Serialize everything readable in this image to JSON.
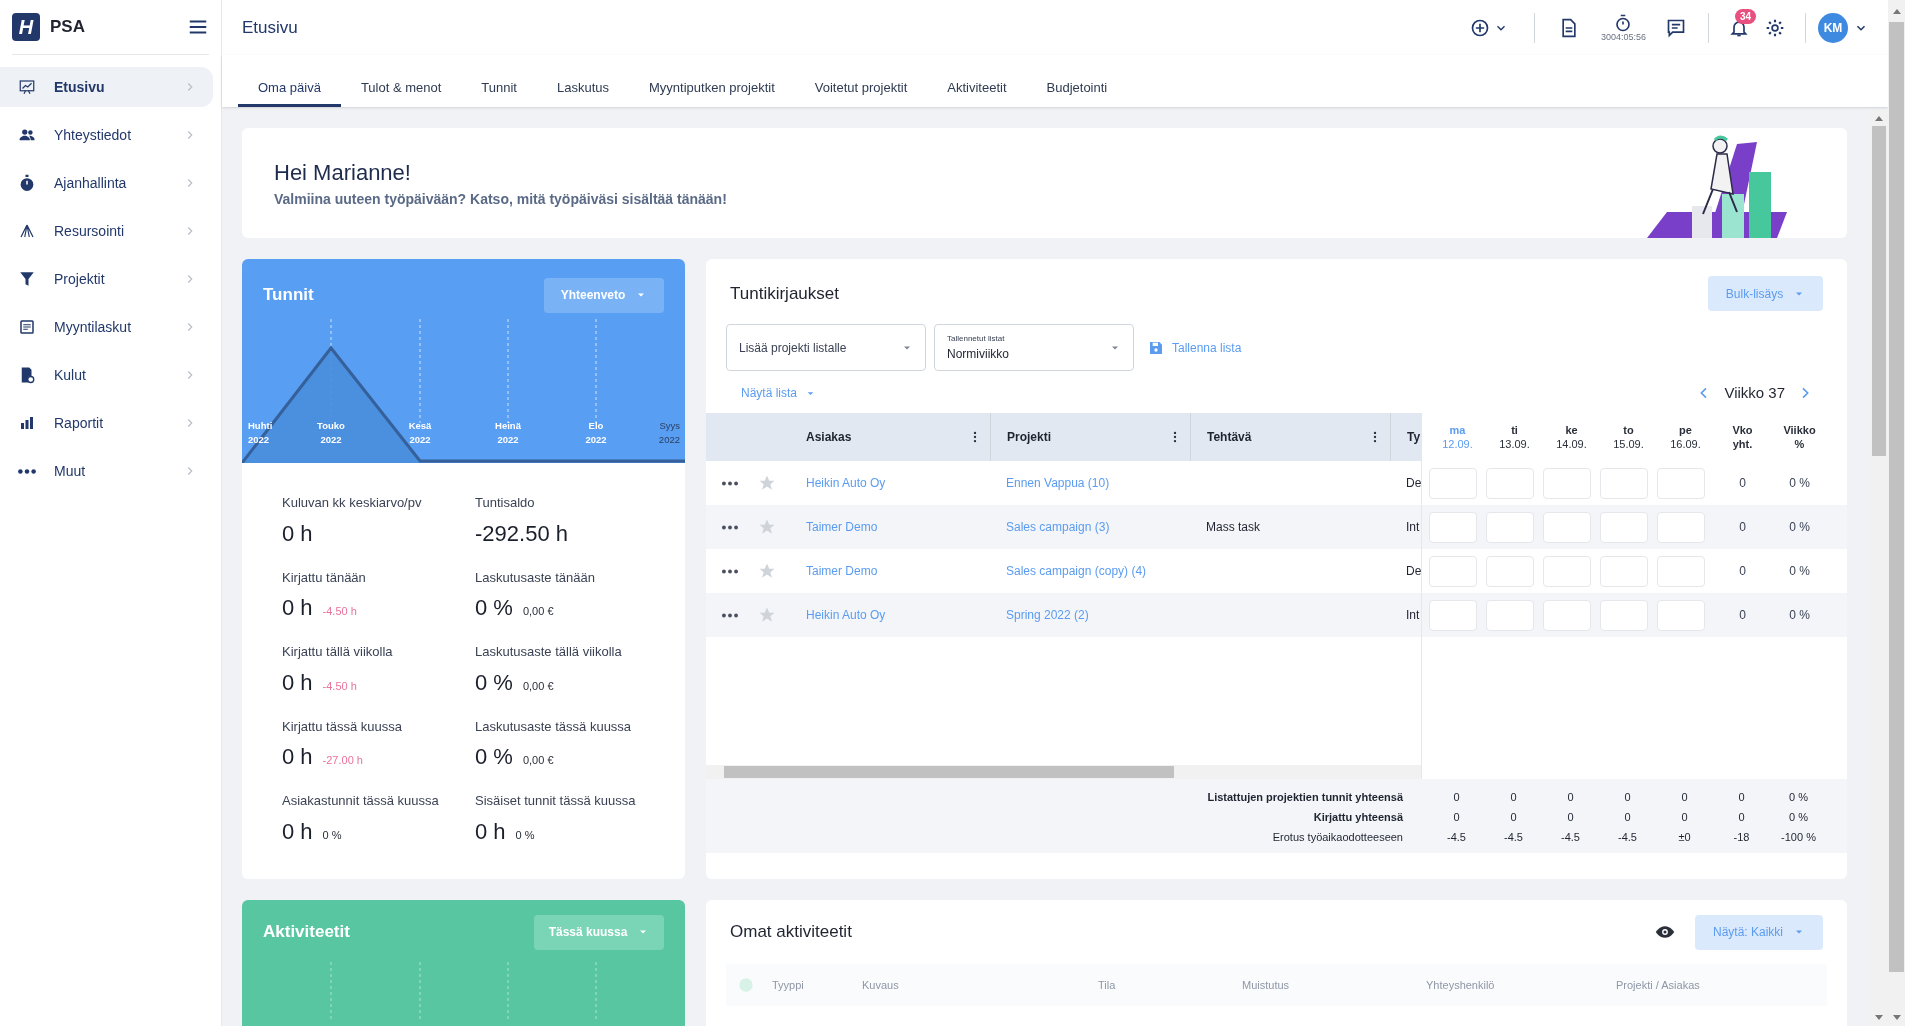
{
  "sidebar": {
    "logo_mark": "H",
    "brand": "PSA",
    "items": [
      {
        "label": "Etusivu",
        "kind": "dashboard",
        "selected": true
      },
      {
        "label": "Yhteystiedot",
        "kind": "people",
        "selected": false
      },
      {
        "label": "Ajanhallinta",
        "kind": "stopwatch",
        "selected": false
      },
      {
        "label": "Resursointi",
        "kind": "network",
        "selected": false
      },
      {
        "label": "Projektit",
        "kind": "funnel",
        "selected": false
      },
      {
        "label": "Myyntilaskut",
        "kind": "invoice",
        "selected": false
      },
      {
        "label": "Kulut",
        "kind": "receipt",
        "selected": false
      },
      {
        "label": "Raportit",
        "kind": "bars",
        "selected": false
      },
      {
        "label": "Muut",
        "kind": "dots",
        "selected": false
      }
    ]
  },
  "topbar": {
    "title": "Etusivu",
    "timer": "3004:05:56",
    "notifications": "34",
    "avatar": "KM"
  },
  "tabs": [
    {
      "label": "Oma päivä",
      "selected": true
    },
    {
      "label": "Tulot & menot",
      "selected": false
    },
    {
      "label": "Tunnit",
      "selected": false
    },
    {
      "label": "Laskutus",
      "selected": false
    },
    {
      "label": "Myyntiputken projektit",
      "selected": false
    },
    {
      "label": "Voitetut projektit",
      "selected": false
    },
    {
      "label": "Aktiviteetit",
      "selected": false
    },
    {
      "label": "Budjetointi",
      "selected": false
    }
  ],
  "greeting": {
    "title": "Hei Marianne!",
    "subtitle": "Valmiina uuteen työpäivään? Katso, mitä työpäiväsi sisältää tänään!"
  },
  "hours_card": {
    "title": "Tunnit",
    "dropdown": "Yhteenveto",
    "months": [
      {
        "month": "Huhti",
        "year": "2022"
      },
      {
        "month": "Touko",
        "year": "2022"
      },
      {
        "month": "Kesä",
        "year": "2022"
      },
      {
        "month": "Heinä",
        "year": "2022"
      },
      {
        "month": "Elo",
        "year": "2022"
      },
      {
        "month": "Syys",
        "year": "2022"
      }
    ],
    "stats": [
      {
        "label": "Kuluvan kk keskiarvo/pv",
        "value": "0 h"
      },
      {
        "label": "Tuntisaldo",
        "value": "-292.50 h"
      },
      {
        "label": "Kirjattu tänään",
        "value": "0 h",
        "note": "-4.50 h",
        "negative": true
      },
      {
        "label": "Laskutusaste tänään",
        "value": "0 %",
        "note": "0,00 €",
        "negative": false
      },
      {
        "label": "Kirjattu tällä viikolla",
        "value": "0 h",
        "note": "-4.50 h",
        "negative": true
      },
      {
        "label": "Laskutusaste tällä viikolla",
        "value": "0 %",
        "note": "0,00 €",
        "negative": false
      },
      {
        "label": "Kirjattu tässä kuussa",
        "value": "0 h",
        "note": "-27.00 h",
        "negative": true
      },
      {
        "label": "Laskutusaste tässä kuussa",
        "value": "0 %",
        "note": "0,00 €",
        "negative": false
      },
      {
        "label": "Asiakastunnit tässä kuussa",
        "value": "0 h",
        "note": "0 %",
        "negative": false
      },
      {
        "label": "Sisäiset tunnit tässä kuussa",
        "value": "0 h",
        "note": "0 %",
        "negative": false
      }
    ]
  },
  "entries_card": {
    "title": "Tuntikirjaukset",
    "bulk_button": "Bulk-lisäys",
    "project_select": {
      "placeholder": "Lisää projekti listalle"
    },
    "saved_lists": {
      "label": "Tallennetut listat",
      "value": "Normiviikko"
    },
    "save_link": "Tallenna lista",
    "show_list": "Näytä lista",
    "week": "Viikko 37",
    "columns": [
      "Asiakas",
      "Projekti",
      "Tehtävä",
      "Ty"
    ],
    "days": [
      {
        "day": "ma",
        "date": "12.09.",
        "selected": true
      },
      {
        "day": "ti",
        "date": "13.09.",
        "selected": false
      },
      {
        "day": "ke",
        "date": "14.09.",
        "selected": false
      },
      {
        "day": "to",
        "date": "15.09.",
        "selected": false
      },
      {
        "day": "pe",
        "date": "16.09.",
        "selected": false
      }
    ],
    "total_columns": [
      {
        "top": "Vko",
        "bottom": "yht."
      },
      {
        "top": "Viikko",
        "bottom": "%"
      }
    ],
    "rows": [
      {
        "customer": "Heikin Auto Oy",
        "project": "Ennen Vappua (10)",
        "type": "De",
        "starred": false,
        "total": "0",
        "percent": "0 %"
      },
      {
        "customer": "Taimer Demo",
        "project": "Sales campaign (3)",
        "task": "Mass task",
        "type": "Int",
        "starred": false,
        "total": "0",
        "percent": "0 %"
      },
      {
        "customer": "Taimer Demo",
        "project": "Sales campaign (copy) (4)",
        "type": "De",
        "starred": false,
        "total": "0",
        "percent": "0 %"
      },
      {
        "customer": "Heikin Auto Oy",
        "project": "Spring 2022 (2)",
        "type": "Int",
        "starred": false,
        "total": "0",
        "percent": "0 %"
      }
    ],
    "footer": [
      {
        "label": "Listattujen projektien tunnit yhteensä",
        "bold": true,
        "values": [
          "0",
          "0",
          "0",
          "0",
          "0",
          "0",
          "0 %"
        ]
      },
      {
        "label": "Kirjattu yhteensä",
        "bold": true,
        "values": [
          "0",
          "0",
          "0",
          "0",
          "0",
          "0",
          "0 %"
        ]
      },
      {
        "label": "Erotus työaikaodotteeseen",
        "bold": false,
        "values": [
          "-4.5",
          "-4.5",
          "-4.5",
          "-4.5",
          "±0",
          "-18",
          "-100 %"
        ]
      }
    ]
  },
  "activities_card": {
    "title": "Aktiviteetit",
    "dropdown": "Tässä kuussa"
  },
  "own_activities": {
    "title": "Omat aktiviteetit",
    "filter_button": "Näytä: Kaikki",
    "columns": [
      "Tyyppi",
      "Kuvaus",
      "Tila",
      "Muistutus",
      "Yhteyshenkilö",
      "Projekti / Asiakas"
    ]
  }
}
